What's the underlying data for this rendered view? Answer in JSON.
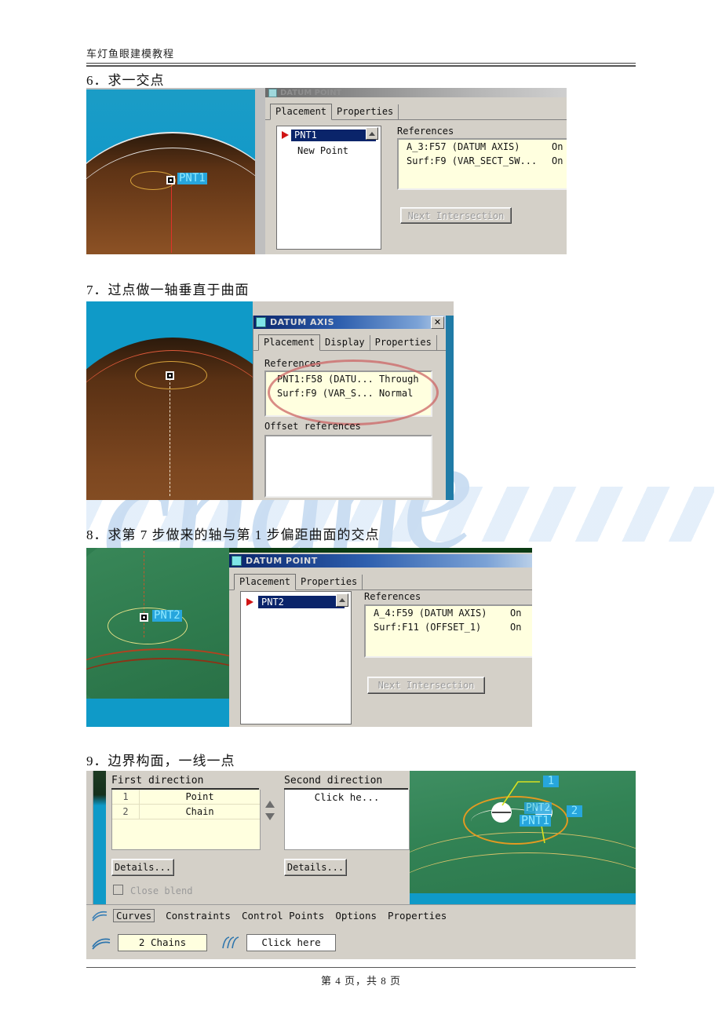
{
  "document": {
    "header_title": "车灯鱼眼建模教程",
    "footer_text": "第 4 页，共 8 页",
    "watermark": "cnane"
  },
  "steps": [
    {
      "caption": "6．求一交点",
      "dialog": {
        "title": "DATUM POINT",
        "tabs": [
          "Placement",
          "Properties"
        ],
        "selected_tab": "Placement",
        "point_list": [
          "PNT1",
          "New Point"
        ],
        "selected_point": "PNT1",
        "references_label": "References",
        "references": [
          {
            "name": "A_3:F57 (DATUM AXIS)",
            "state": "On"
          },
          {
            "name": "Surf:F9 (VAR_SECT_SW...",
            "state": "On"
          }
        ],
        "next_button": "Next Intersection"
      },
      "viewport": {
        "point_label": "PNT1"
      }
    },
    {
      "caption": "7．过点做一轴垂直于曲面",
      "dialog": {
        "title": "DATUM AXIS",
        "tabs": [
          "Placement",
          "Display",
          "Properties"
        ],
        "selected_tab": "Placement",
        "close_label": "✕",
        "references_label": "References",
        "references": [
          {
            "name": "PNT1:F58 (DATU...",
            "state": "Through"
          },
          {
            "name": "Surf:F9 (VAR_S...",
            "state": "Normal"
          }
        ],
        "offset_label": "Offset references"
      }
    },
    {
      "caption": "8．求第 7 步做来的轴与第 1 步偏距曲面的交点",
      "dialog": {
        "title": "DATUM POINT",
        "tabs": [
          "Placement",
          "Properties"
        ],
        "selected_tab": "Placement",
        "point_list": [
          "PNT2"
        ],
        "selected_point": "PNT2",
        "references_label": "References",
        "references": [
          {
            "name": "A_4:F59 (DATUM AXIS)",
            "state": "On"
          },
          {
            "name": "Surf:F11 (OFFSET_1)",
            "state": "On"
          }
        ],
        "next_button": "Next Intersection"
      },
      "viewport": {
        "point_label": "PNT2"
      }
    },
    {
      "caption": "9．边界构面，一线一点",
      "panel": {
        "first_direction_label": "First direction",
        "first_direction_rows": [
          {
            "index": "1",
            "value": "Point"
          },
          {
            "index": "2",
            "value": "Chain"
          }
        ],
        "second_direction_label": "Second direction",
        "second_direction_placeholder": "Click he...",
        "details_button_left": "Details...",
        "details_button_right": "Details...",
        "close_blend_label": "Close blend",
        "bottom_tabs": [
          "Curves",
          "Constraints",
          "Control Points",
          "Options",
          "Properties"
        ],
        "selected_bottom_tab": "Curves",
        "chains_field": "2 Chains",
        "click_here_field": "Click here"
      },
      "viewport": {
        "labels": [
          "1",
          "2"
        ],
        "point_labels": [
          "PNT2",
          "PNT1"
        ]
      }
    }
  ],
  "colors": {
    "title_bar_start": "#0a246a",
    "dialog_face": "#d4d0c8",
    "reference_list_bg": "#ffffdf",
    "selection_blue": "#0a246a",
    "viewport_sky": "#0f9ac8",
    "viewport_green": "#2f7d4f",
    "label_badge": "#27a6dd"
  }
}
